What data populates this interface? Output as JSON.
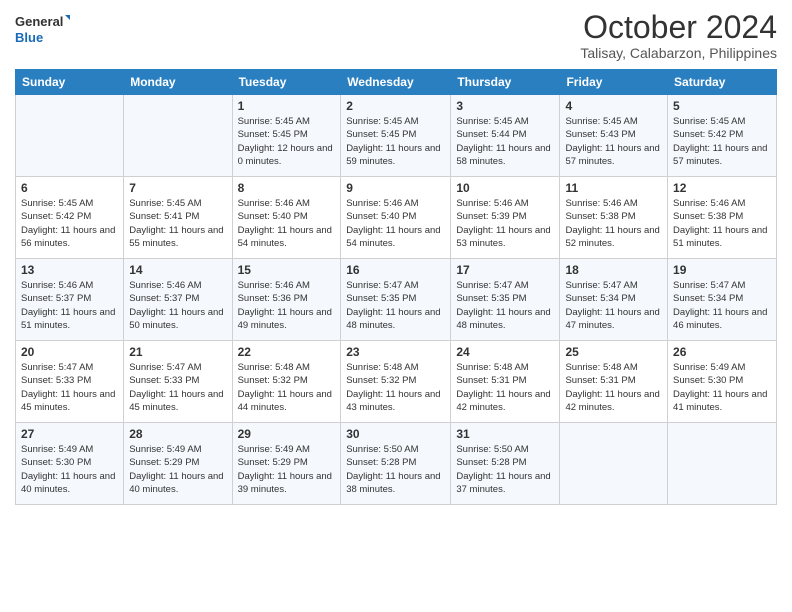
{
  "logo": {
    "line1": "General",
    "line2": "Blue"
  },
  "title": "October 2024",
  "subtitle": "Talisay, Calabarzon, Philippines",
  "weekdays": [
    "Sunday",
    "Monday",
    "Tuesday",
    "Wednesday",
    "Thursday",
    "Friday",
    "Saturday"
  ],
  "weeks": [
    [
      {
        "day": "",
        "info": ""
      },
      {
        "day": "",
        "info": ""
      },
      {
        "day": "1",
        "info": "Sunrise: 5:45 AM\nSunset: 5:45 PM\nDaylight: 12 hours\nand 0 minutes."
      },
      {
        "day": "2",
        "info": "Sunrise: 5:45 AM\nSunset: 5:45 PM\nDaylight: 11 hours\nand 59 minutes."
      },
      {
        "day": "3",
        "info": "Sunrise: 5:45 AM\nSunset: 5:44 PM\nDaylight: 11 hours\nand 58 minutes."
      },
      {
        "day": "4",
        "info": "Sunrise: 5:45 AM\nSunset: 5:43 PM\nDaylight: 11 hours\nand 57 minutes."
      },
      {
        "day": "5",
        "info": "Sunrise: 5:45 AM\nSunset: 5:42 PM\nDaylight: 11 hours\nand 57 minutes."
      }
    ],
    [
      {
        "day": "6",
        "info": "Sunrise: 5:45 AM\nSunset: 5:42 PM\nDaylight: 11 hours\nand 56 minutes."
      },
      {
        "day": "7",
        "info": "Sunrise: 5:45 AM\nSunset: 5:41 PM\nDaylight: 11 hours\nand 55 minutes."
      },
      {
        "day": "8",
        "info": "Sunrise: 5:46 AM\nSunset: 5:40 PM\nDaylight: 11 hours\nand 54 minutes."
      },
      {
        "day": "9",
        "info": "Sunrise: 5:46 AM\nSunset: 5:40 PM\nDaylight: 11 hours\nand 54 minutes."
      },
      {
        "day": "10",
        "info": "Sunrise: 5:46 AM\nSunset: 5:39 PM\nDaylight: 11 hours\nand 53 minutes."
      },
      {
        "day": "11",
        "info": "Sunrise: 5:46 AM\nSunset: 5:38 PM\nDaylight: 11 hours\nand 52 minutes."
      },
      {
        "day": "12",
        "info": "Sunrise: 5:46 AM\nSunset: 5:38 PM\nDaylight: 11 hours\nand 51 minutes."
      }
    ],
    [
      {
        "day": "13",
        "info": "Sunrise: 5:46 AM\nSunset: 5:37 PM\nDaylight: 11 hours\nand 51 minutes."
      },
      {
        "day": "14",
        "info": "Sunrise: 5:46 AM\nSunset: 5:37 PM\nDaylight: 11 hours\nand 50 minutes."
      },
      {
        "day": "15",
        "info": "Sunrise: 5:46 AM\nSunset: 5:36 PM\nDaylight: 11 hours\nand 49 minutes."
      },
      {
        "day": "16",
        "info": "Sunrise: 5:47 AM\nSunset: 5:35 PM\nDaylight: 11 hours\nand 48 minutes."
      },
      {
        "day": "17",
        "info": "Sunrise: 5:47 AM\nSunset: 5:35 PM\nDaylight: 11 hours\nand 48 minutes."
      },
      {
        "day": "18",
        "info": "Sunrise: 5:47 AM\nSunset: 5:34 PM\nDaylight: 11 hours\nand 47 minutes."
      },
      {
        "day": "19",
        "info": "Sunrise: 5:47 AM\nSunset: 5:34 PM\nDaylight: 11 hours\nand 46 minutes."
      }
    ],
    [
      {
        "day": "20",
        "info": "Sunrise: 5:47 AM\nSunset: 5:33 PM\nDaylight: 11 hours\nand 45 minutes."
      },
      {
        "day": "21",
        "info": "Sunrise: 5:47 AM\nSunset: 5:33 PM\nDaylight: 11 hours\nand 45 minutes."
      },
      {
        "day": "22",
        "info": "Sunrise: 5:48 AM\nSunset: 5:32 PM\nDaylight: 11 hours\nand 44 minutes."
      },
      {
        "day": "23",
        "info": "Sunrise: 5:48 AM\nSunset: 5:32 PM\nDaylight: 11 hours\nand 43 minutes."
      },
      {
        "day": "24",
        "info": "Sunrise: 5:48 AM\nSunset: 5:31 PM\nDaylight: 11 hours\nand 42 minutes."
      },
      {
        "day": "25",
        "info": "Sunrise: 5:48 AM\nSunset: 5:31 PM\nDaylight: 11 hours\nand 42 minutes."
      },
      {
        "day": "26",
        "info": "Sunrise: 5:49 AM\nSunset: 5:30 PM\nDaylight: 11 hours\nand 41 minutes."
      }
    ],
    [
      {
        "day": "27",
        "info": "Sunrise: 5:49 AM\nSunset: 5:30 PM\nDaylight: 11 hours\nand 40 minutes."
      },
      {
        "day": "28",
        "info": "Sunrise: 5:49 AM\nSunset: 5:29 PM\nDaylight: 11 hours\nand 40 minutes."
      },
      {
        "day": "29",
        "info": "Sunrise: 5:49 AM\nSunset: 5:29 PM\nDaylight: 11 hours\nand 39 minutes."
      },
      {
        "day": "30",
        "info": "Sunrise: 5:50 AM\nSunset: 5:28 PM\nDaylight: 11 hours\nand 38 minutes."
      },
      {
        "day": "31",
        "info": "Sunrise: 5:50 AM\nSunset: 5:28 PM\nDaylight: 11 hours\nand 37 minutes."
      },
      {
        "day": "",
        "info": ""
      },
      {
        "day": "",
        "info": ""
      }
    ]
  ]
}
